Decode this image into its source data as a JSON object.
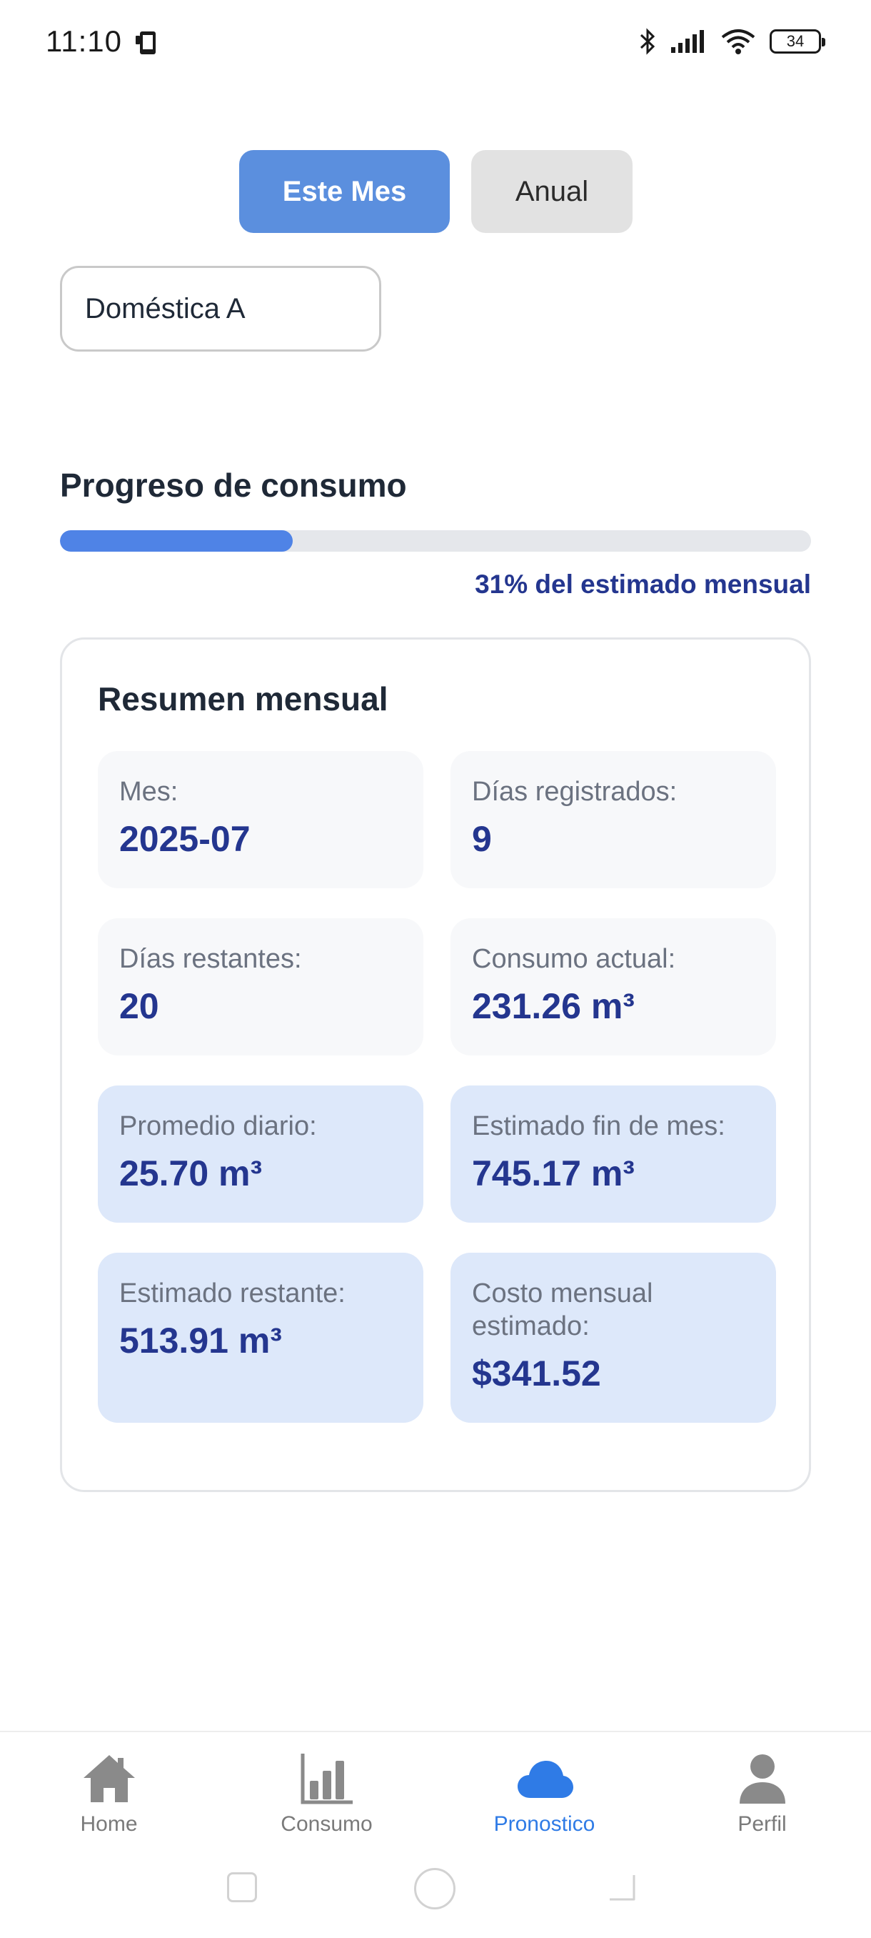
{
  "status_bar": {
    "time": "11:10",
    "battery": "34",
    "icons": [
      "phone-icon",
      "bluetooth-icon",
      "signal-icon",
      "wifi-icon",
      "battery-icon"
    ]
  },
  "tabs": {
    "month_label": "Este Mes",
    "annual_label": "Anual",
    "active": "month"
  },
  "category": {
    "selected": "Doméstica A"
  },
  "progress": {
    "title": "Progreso de consumo",
    "percent": 31,
    "caption": "31% del estimado mensual"
  },
  "summary": {
    "title": "Resumen mensual",
    "stats": [
      {
        "label": "Mes:",
        "value": "2025-07"
      },
      {
        "label": "Días registrados:",
        "value": "9"
      },
      {
        "label": "Días restantes:",
        "value": "20"
      },
      {
        "label": "Consumo actual:",
        "value": "231.26 m³"
      },
      {
        "label": "Promedio diario:",
        "value": "25.70 m³"
      },
      {
        "label": "Estimado fin de mes:",
        "value": "745.17 m³"
      },
      {
        "label": "Estimado restante:",
        "value": "513.91 m³"
      },
      {
        "label": "Costo mensual estimado:",
        "value": "$341.52"
      }
    ]
  },
  "nav": {
    "items": [
      {
        "label": "Home",
        "icon": "home-icon"
      },
      {
        "label": "Consumo",
        "icon": "bar-chart-icon"
      },
      {
        "label": "Pronostico",
        "icon": "cloud-icon"
      },
      {
        "label": "Perfil",
        "icon": "person-icon"
      }
    ],
    "active": "Pronostico"
  },
  "colors": {
    "accent": "#5b8fde",
    "progress": "#4f83e6",
    "value_text": "#24368f",
    "highlight_card": "#dde8fa",
    "nav_active": "#2f7be6"
  }
}
